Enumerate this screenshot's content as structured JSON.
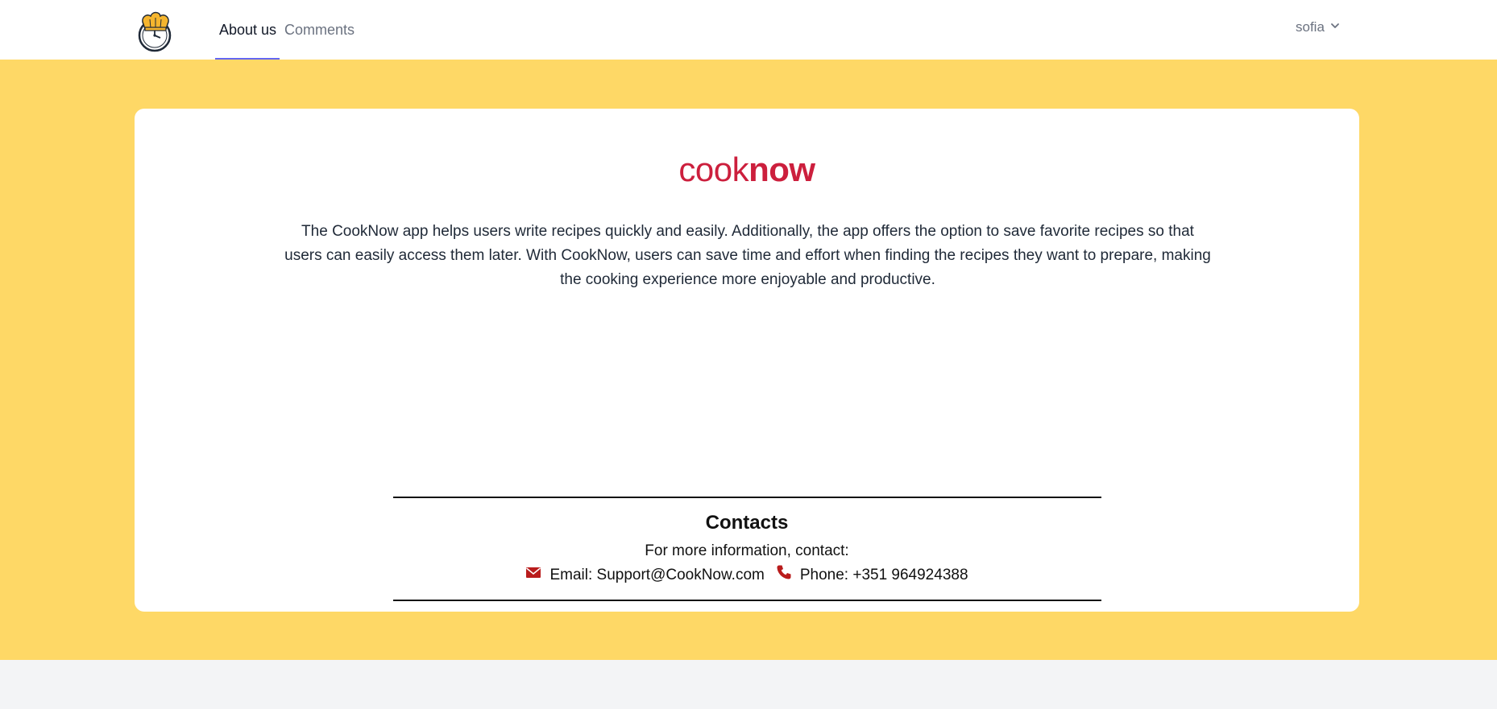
{
  "header": {
    "logo_icon": "chef-hat-clock-icon",
    "tabs": [
      {
        "label": "About us",
        "active": true
      },
      {
        "label": "Comments",
        "active": false
      }
    ],
    "user": {
      "name": "sofia",
      "icon": "chevron-down-icon"
    }
  },
  "main": {
    "brand": {
      "light": "cook",
      "bold": "now"
    },
    "intro": "The CookNow app helps users write recipes quickly and easily. Additionally, the app offers the option to save favorite recipes so that users can easily access them later. With CookNow, users can save time and effort when finding the recipes they want to prepare, making the cooking experience more enjoyable and productive.",
    "contacts": {
      "title": "Contacts",
      "subtitle": "For more information, contact:",
      "email": {
        "icon": "envelope-icon",
        "label": "Email: Support@CookNow.com"
      },
      "phone": {
        "icon": "phone-icon",
        "label": "Phone: +351 964924388"
      }
    }
  },
  "colors": {
    "background_band": "#fed866",
    "brand_red": "#cc1f3d",
    "tab_indicator": "#6366f1",
    "icon_red": "#b91c1c"
  }
}
